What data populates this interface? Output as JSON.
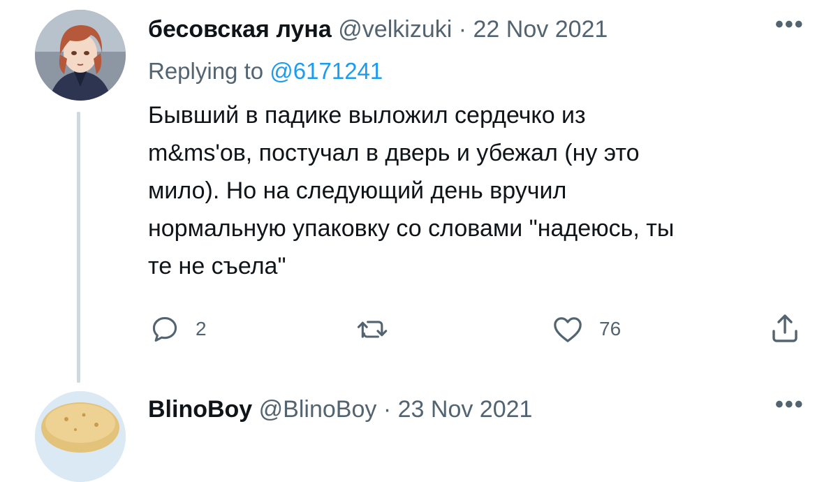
{
  "tweet": {
    "display_name": "бесовская луна",
    "handle": "@velkizuki",
    "separator": "·",
    "date": "22 Nov 2021",
    "replying_prefix": "Replying to",
    "replying_to": "@6171241",
    "text_lines": [
      "Бывший в падике выложил сердечко из",
      "m&ms'ов, постучал в дверь и убежал (ну это",
      "мило). Но на следующий день вручил",
      "нормальную упаковку со словами \"надеюсь, ты",
      "те не съела\""
    ],
    "reply_count": "2",
    "like_count": "76",
    "more": "•••"
  },
  "next_tweet": {
    "display_name": "BlinoBoy",
    "handle": "@BlinoBoy",
    "separator": "·",
    "date": "23 Nov 2021",
    "more": "•••"
  },
  "colors": {
    "text": "#0f1419",
    "secondary": "#536471",
    "accent": "#1d9bf0",
    "thread_line": "#cfd9de"
  },
  "icons": [
    "reply-icon",
    "retweet-icon",
    "like-icon",
    "share-icon",
    "more-icon"
  ]
}
